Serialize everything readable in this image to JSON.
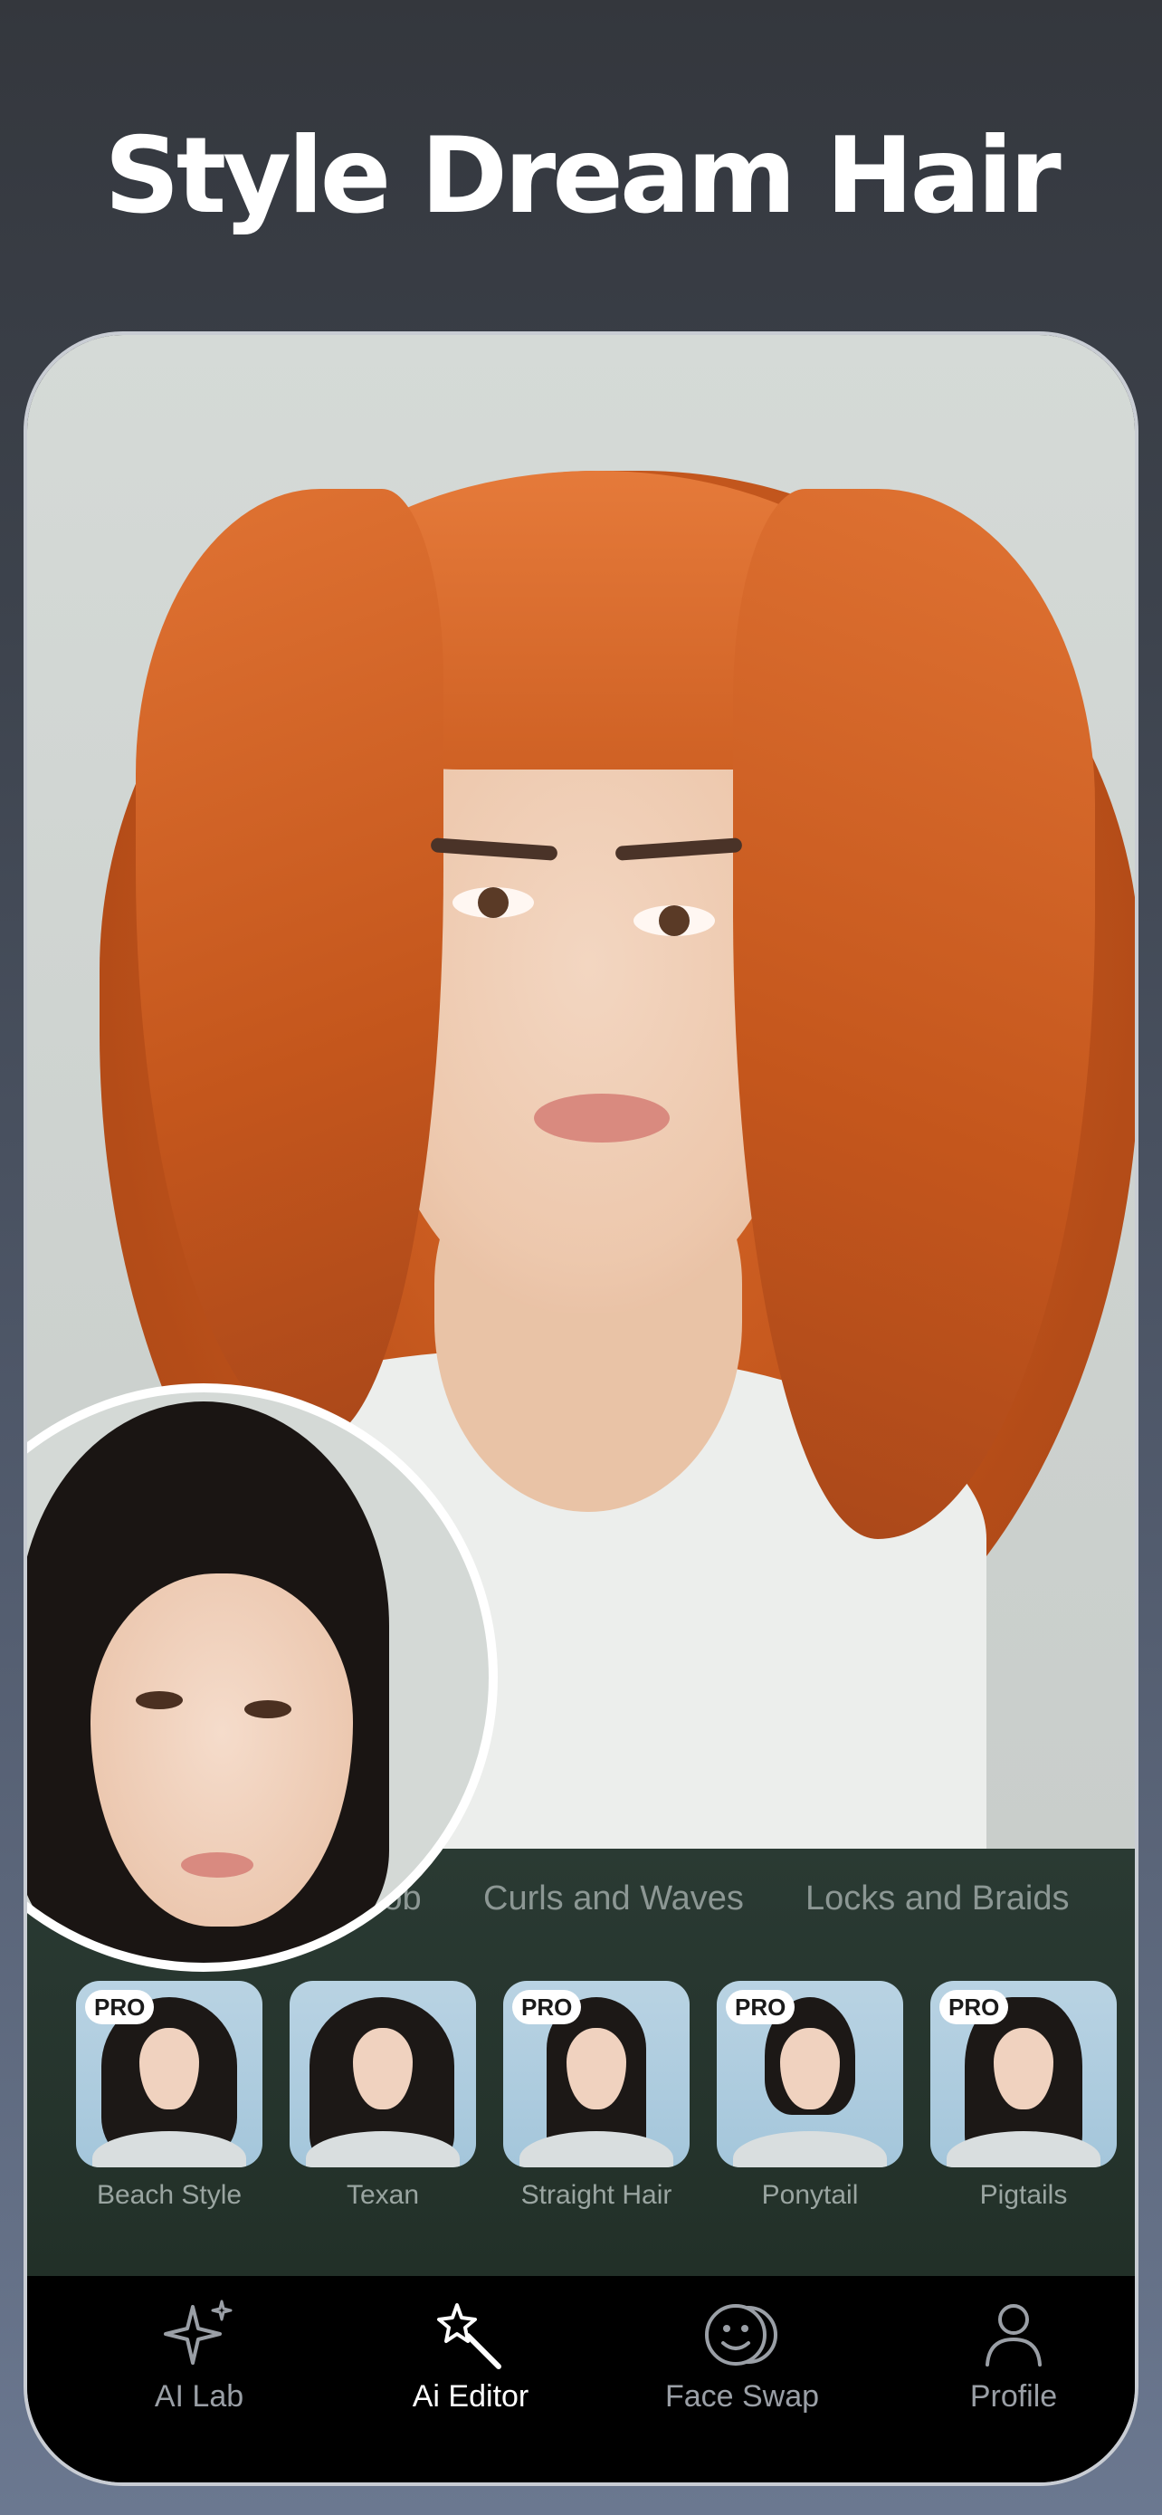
{
  "headline": "Style Dream Hair",
  "categories": [
    "Bob",
    "Curls and Waves",
    "Locks and Braids"
  ],
  "styles": [
    {
      "label": "Beach Style",
      "pro": true
    },
    {
      "label": "Texan",
      "pro": false
    },
    {
      "label": "Straight Hair",
      "pro": true
    },
    {
      "label": "Ponytail",
      "pro": true
    },
    {
      "label": "Pigtails",
      "pro": true
    }
  ],
  "pro_badge": "PRO",
  "tabs": [
    {
      "label": "AI Lab",
      "icon": "sparkle-icon"
    },
    {
      "label": "Ai Editor",
      "icon": "magic-wand-icon",
      "active": true
    },
    {
      "label": "Face Swap",
      "icon": "face-swap-icon"
    },
    {
      "label": "Profile",
      "icon": "person-icon"
    }
  ],
  "colors": {
    "hair_accent": "#c85a1f",
    "active_tab": "#ffffff",
    "inactive_tab": "#9a9fa6"
  }
}
